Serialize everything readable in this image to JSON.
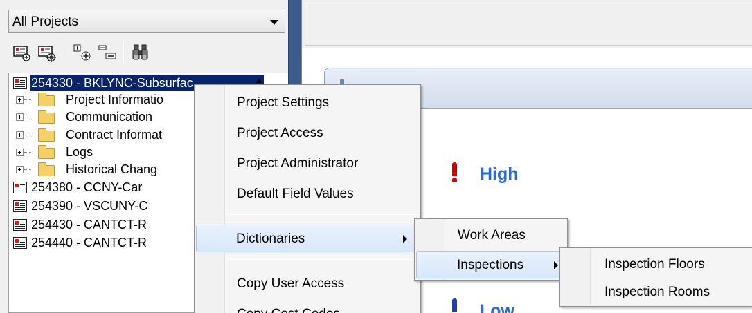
{
  "project_selector": {
    "value": "All Projects"
  },
  "toolbar": {
    "buttons": [
      "project-properties-icon",
      "project-settings-icon",
      "expand-all-icon",
      "collapse-all-icon",
      "find-icon"
    ]
  },
  "tree": {
    "selected_project": "254330 - BKLYNC-Subsurfac",
    "folders": [
      {
        "label": "Project Informatio"
      },
      {
        "label": "Communication"
      },
      {
        "label": "Contract Informat"
      },
      {
        "label": "Logs"
      },
      {
        "label": "Historical Chang"
      }
    ],
    "other_projects": [
      {
        "label": "254380 - CCNY-Car"
      },
      {
        "label": "254390 - VSCUNY-C"
      },
      {
        "label": "254430 - CANTCT-R"
      },
      {
        "label": "254440 - CANTCT-R"
      }
    ]
  },
  "right_panel": {
    "header_char": "I",
    "priorities": [
      {
        "label": "High",
        "color": "#d40000"
      },
      {
        "label": "Low",
        "color": "#1e3fb8"
      }
    ]
  },
  "context_menu": {
    "items": [
      {
        "label": "Project Settings"
      },
      {
        "label": "Project Access"
      },
      {
        "label": "Project Administrator"
      },
      {
        "label": "Default Field Values"
      }
    ],
    "dictionaries": {
      "label": "Dictionaries"
    },
    "lower_items": [
      {
        "label": "Copy User Access"
      },
      {
        "label": "Copy Cost Codes"
      }
    ]
  },
  "dictionaries_menu": {
    "items": [
      {
        "label": "Work Areas"
      },
      {
        "label": "Inspections"
      }
    ]
  },
  "inspections_menu": {
    "items": [
      {
        "label": "Inspection Floors"
      },
      {
        "label": "Inspection Rooms"
      }
    ]
  }
}
